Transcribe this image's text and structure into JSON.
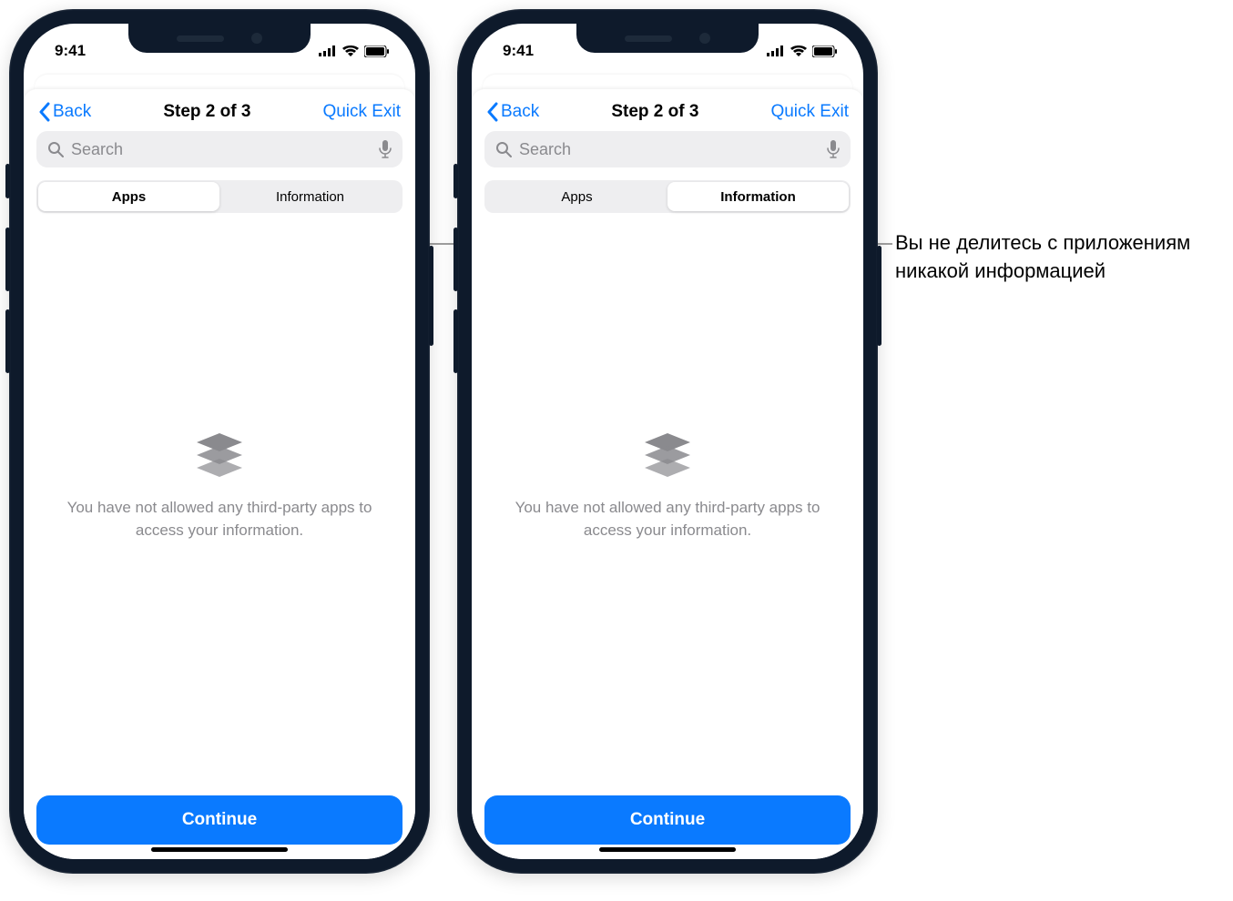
{
  "status": {
    "time": "9:41"
  },
  "nav": {
    "back": "Back",
    "title": "Step 2 of 3",
    "exit": "Quick Exit"
  },
  "search": {
    "placeholder": "Search"
  },
  "tabs": {
    "apps": "Apps",
    "info": "Information"
  },
  "empty": {
    "message": "You have not allowed any third-party apps to access your information."
  },
  "action": {
    "continue": "Continue"
  },
  "callout": {
    "text": "Вы не делитесь с приложениям никакой информацией"
  }
}
